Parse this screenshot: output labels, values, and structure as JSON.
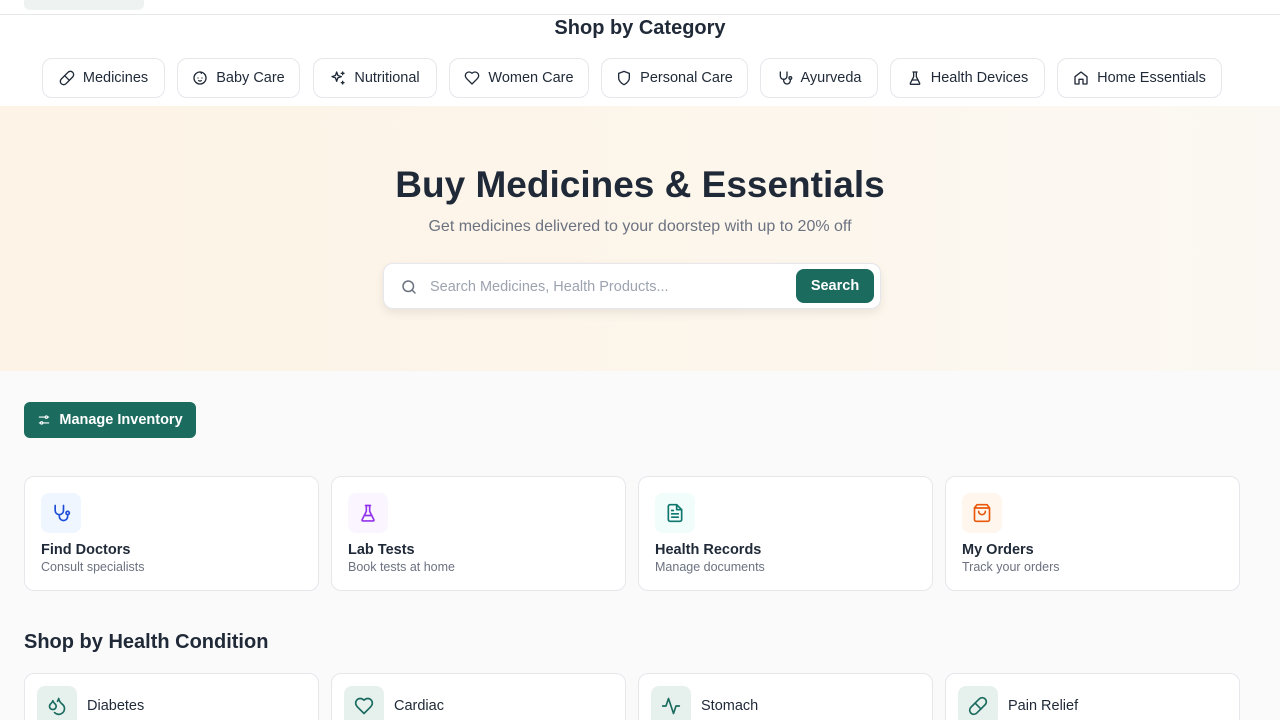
{
  "categories": {
    "title": "Shop by Category",
    "items": [
      {
        "label": "Medicines",
        "icon": "pill-icon"
      },
      {
        "label": "Baby Care",
        "icon": "baby-icon"
      },
      {
        "label": "Nutritional",
        "icon": "sparkles-icon"
      },
      {
        "label": "Women Care",
        "icon": "heart-icon"
      },
      {
        "label": "Personal Care",
        "icon": "shield-icon"
      },
      {
        "label": "Ayurveda",
        "icon": "stethoscope-icon"
      },
      {
        "label": "Health Devices",
        "icon": "flask-icon"
      },
      {
        "label": "Home Essentials",
        "icon": "home-icon"
      }
    ]
  },
  "hero": {
    "title": "Buy Medicines & Essentials",
    "subtitle": "Get medicines delivered to your doorstep with up to 20% off",
    "search_placeholder": "Search Medicines, Health Products...",
    "search_value": "",
    "search_button": "Search"
  },
  "actions": {
    "manage_inventory": "Manage Inventory"
  },
  "services": [
    {
      "title": "Find Doctors",
      "subtitle": "Consult specialists",
      "icon": "stethoscope-icon",
      "color": "#1d4ed8",
      "bg": "#eff6ff"
    },
    {
      "title": "Lab Tests",
      "subtitle": "Book tests at home",
      "icon": "flask-icon",
      "color": "#9333ea",
      "bg": "#faf5ff"
    },
    {
      "title": "Health Records",
      "subtitle": "Manage documents",
      "icon": "file-text-icon",
      "color": "#0f766e",
      "bg": "#f0fdfa"
    },
    {
      "title": "My Orders",
      "subtitle": "Track your orders",
      "icon": "shopping-bag-icon",
      "color": "#ea580c",
      "bg": "#fff7ed"
    }
  ],
  "conditions": {
    "title": "Shop by Health Condition",
    "items": [
      {
        "label": "Diabetes",
        "icon": "droplets-icon"
      },
      {
        "label": "Cardiac",
        "icon": "heart-icon"
      },
      {
        "label": "Stomach",
        "icon": "activity-icon"
      },
      {
        "label": "Pain Relief",
        "icon": "pill-icon"
      }
    ]
  },
  "colors": {
    "primary": "#1b6b5f",
    "hero_bg": "#fdf3e6",
    "border": "#e5e7eb"
  }
}
